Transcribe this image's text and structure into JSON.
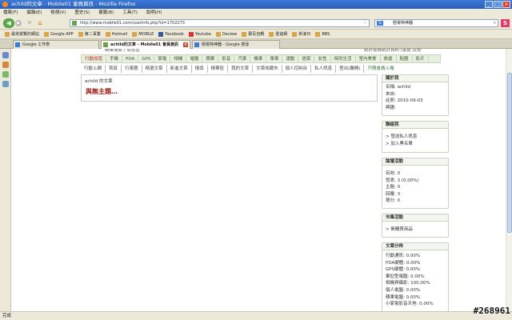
{
  "window": {
    "title": "achild的文章 - Mobile01 會員資訊 - Mozilla Firefox",
    "controls": [
      "_",
      "□",
      "×"
    ]
  },
  "menubar": [
    "檔案(F)",
    "編輯(E)",
    "檢視(V)",
    "歷史(S)",
    "書籤(B)",
    "工具(T)",
    "說明(H)"
  ],
  "nav": {
    "url": "http://www.mobile01.com/userinfo.php?id=1702273",
    "search_value": "極電特神器",
    "search_engine": "G",
    "ext_label": "S"
  },
  "bookmarks": [
    "最常瀏覽的網站",
    "Google APP",
    "第二事業",
    "Hotmail",
    "MOBILE",
    "Facebook",
    "Youtube",
    "Deview",
    "鄭尼自轉",
    "愛遊網",
    "新浪日",
    "BBS"
  ],
  "tabs": [
    {
      "label": "Google 工作表"
    },
    {
      "label": "achild的文章 - Mobile01 會員資訊"
    },
    {
      "label": "極電特神器 - Google 搜尋"
    }
  ],
  "page": {
    "trunc_left": "精華搜索 / 問答區",
    "trunc_right": "統計會員統計資料 /瀏覽 其他",
    "categories": [
      "行動加值",
      "手機",
      "PDA",
      "GPS",
      "家電",
      "相機",
      "電腦",
      "蘋果",
      "影音",
      "汽車",
      "機車",
      "單車",
      "運動",
      "居家",
      "女性",
      "時尚生活",
      "室內美食",
      "旅遊",
      "貼圖",
      "影片"
    ],
    "subnav": [
      "行動上網",
      "首頁",
      "行事曆",
      "精選文章",
      "新進文章",
      "搜尋",
      "精華區",
      "我的文章",
      "文章收藏夾",
      "個人控制台",
      "私人訊息",
      "登出(離開)",
      "只限會員入場"
    ],
    "article_header": "achild 的文章",
    "headline": "與無主題…",
    "panels": {
      "profile": {
        "title": "關於我",
        "lines": [
          "名稱: achild",
          "來自:",
          "註冊: 2010-09-03",
          "興趣:"
        ]
      },
      "contact": {
        "title": "聯絡我",
        "lines": [
          "> 發送私人訊息",
          "> 加入黑名單"
        ]
      },
      "activity": {
        "title": "論壇活動",
        "lines": [
          "有效: 0",
          "發表: 3 (0.00%)",
          "主題: 0",
          "回覆: 3",
          "積分: 0"
        ]
      },
      "market": {
        "title": "市集活動",
        "lines": [
          "> 無購買商品"
        ]
      },
      "dist": {
        "title": "文章分佈",
        "lines": [
          "行動通訊: 0.00%",
          "PDA硬體: 0.00%",
          "GPS硬體: 0.00%",
          "筆記型電腦: 0.00%",
          "相機與攝影: 100.00%",
          "個人電腦: 0.00%",
          "蘋果電腦: 0.00%",
          "小家電影音天地: 0.00%"
        ]
      }
    }
  },
  "status": "完成",
  "watermark": "#268961"
}
